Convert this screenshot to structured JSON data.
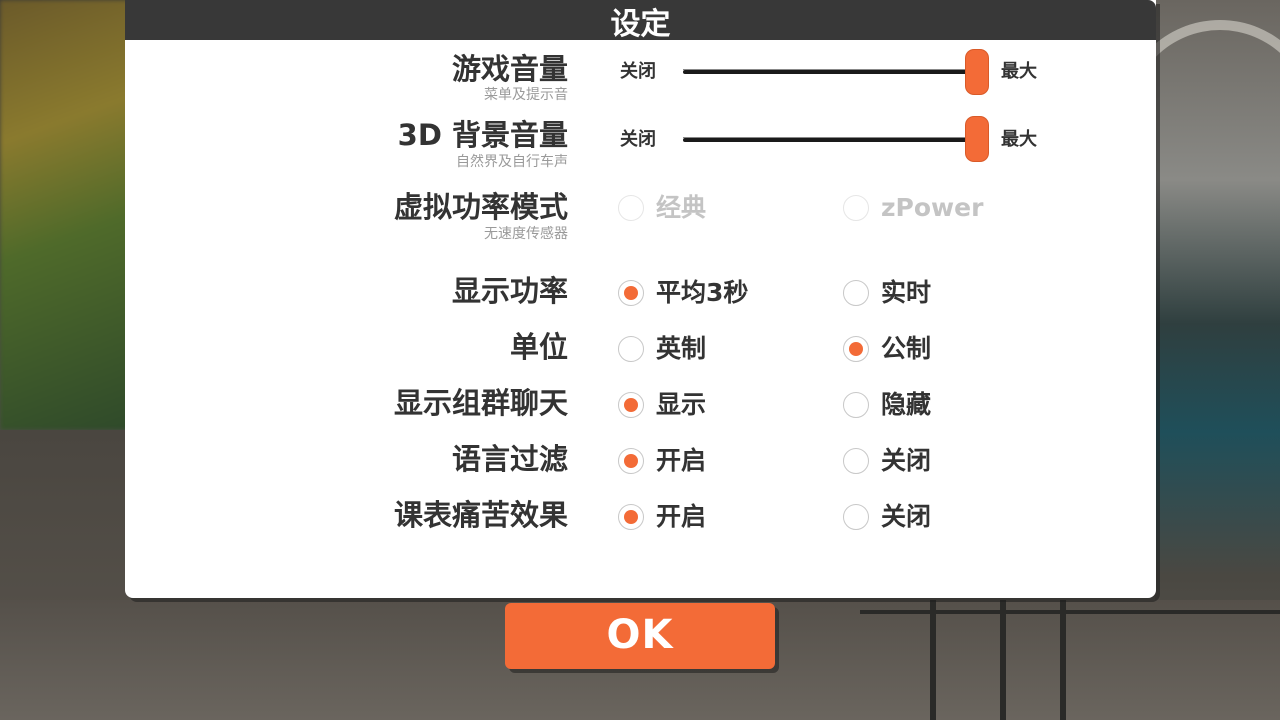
{
  "dialog": {
    "title": "设定",
    "ok_label": "OK"
  },
  "colors": {
    "accent": "#f36b37",
    "titlebar": "#383838",
    "panel": "#ffffff"
  },
  "game_volume": {
    "label": "游戏音量",
    "sublabel": "菜单及提示音",
    "min_label": "关闭",
    "max_label": "最大",
    "level": 1.0
  },
  "bg_volume": {
    "label": "3D 背景音量",
    "sublabel": "自然界及自行车声",
    "min_label": "关闭",
    "max_label": "最大",
    "level": 1.0
  },
  "power_mode": {
    "label": "虚拟功率模式",
    "sublabel": "无速度传感器",
    "disabled": true,
    "options": [
      {
        "label": "经典",
        "selected": false
      },
      {
        "label": "zPower",
        "selected": false
      }
    ]
  },
  "show_power": {
    "label": "显示功率",
    "options": [
      {
        "label": "平均3秒",
        "selected": true
      },
      {
        "label": "实时",
        "selected": false
      }
    ]
  },
  "units": {
    "label": "单位",
    "options": [
      {
        "label": "英制",
        "selected": false
      },
      {
        "label": "公制",
        "selected": true
      }
    ]
  },
  "group_chat": {
    "label": "显示组群聊天",
    "options": [
      {
        "label": "显示",
        "selected": true
      },
      {
        "label": "隐藏",
        "selected": false
      }
    ]
  },
  "language_filter": {
    "label": "语言过滤",
    "options": [
      {
        "label": "开启",
        "selected": true
      },
      {
        "label": "关闭",
        "selected": false
      }
    ]
  },
  "workout_pain": {
    "label": "课表痛苦效果",
    "options": [
      {
        "label": "开启",
        "selected": true
      },
      {
        "label": "关闭",
        "selected": false
      }
    ]
  }
}
